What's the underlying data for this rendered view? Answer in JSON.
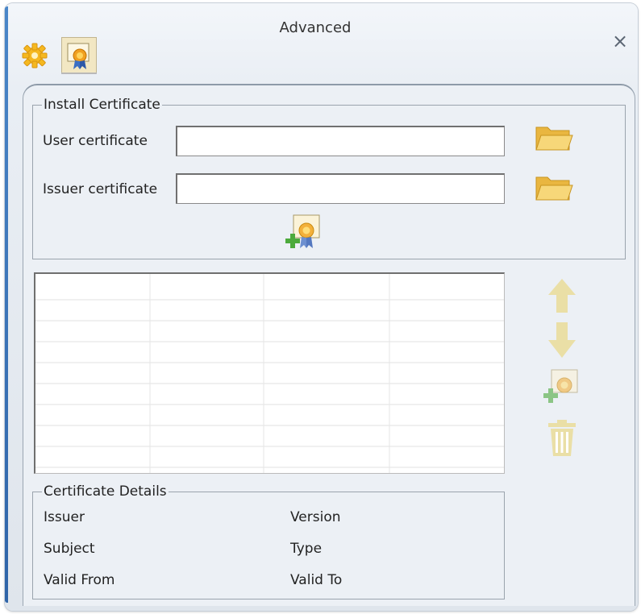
{
  "window": {
    "title": "Advanced",
    "close_glyph": "×"
  },
  "tabs": [
    {
      "name": "settings-tab",
      "icon": "gear-icon"
    },
    {
      "name": "certificate-tab",
      "icon": "certificate-icon",
      "selected": true
    }
  ],
  "install": {
    "legend": "Install Certificate",
    "user_label": "User certificate",
    "user_value": "",
    "issuer_label": "Issuer certificate",
    "issuer_value": ""
  },
  "certificate_table": {
    "column_count": 4,
    "row_count": 9,
    "rows": []
  },
  "details": {
    "legend": "Certificate Details",
    "issuer_label": "Issuer",
    "version_label": "Version",
    "subject_label": "Subject",
    "type_label": "Type",
    "valid_from_label": "Valid From",
    "valid_to_label": "Valid To"
  },
  "colors": {
    "folder": "#f2c85a",
    "disabled_icon": "#eadfa6",
    "panel": "#ecf0f5",
    "accent": "#2f64a8"
  }
}
